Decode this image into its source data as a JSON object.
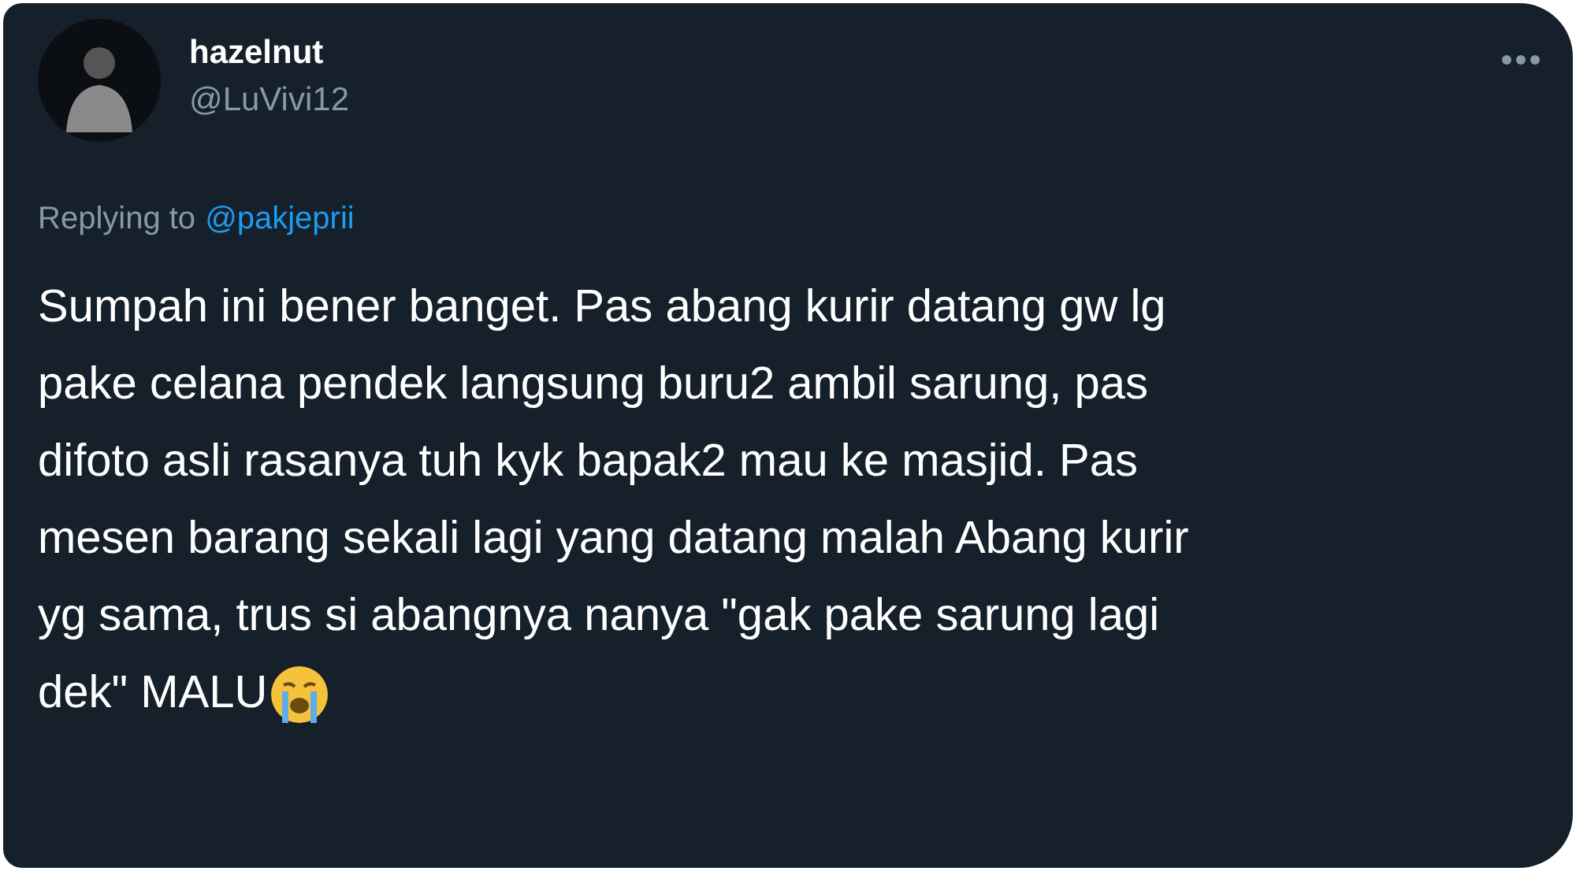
{
  "tweet": {
    "display_name": "hazelnut",
    "handle": "@LuVivi12",
    "reply_prefix": "Replying to",
    "reply_to": "@pakjeprii",
    "text_lines": [
      "Sumpah ini bener banget. Pas abang kurir datang gw lg",
      "pake celana pendek langsung buru2 ambil sarung, pas",
      "difoto asli rasanya tuh kyk bapak2 mau ke masjid. Pas",
      "mesen barang sekali lagi yang datang malah Abang kurir",
      "yg sama, trus si abangnya nanya \"gak pake sarung lagi",
      "dek\" MALU"
    ]
  }
}
